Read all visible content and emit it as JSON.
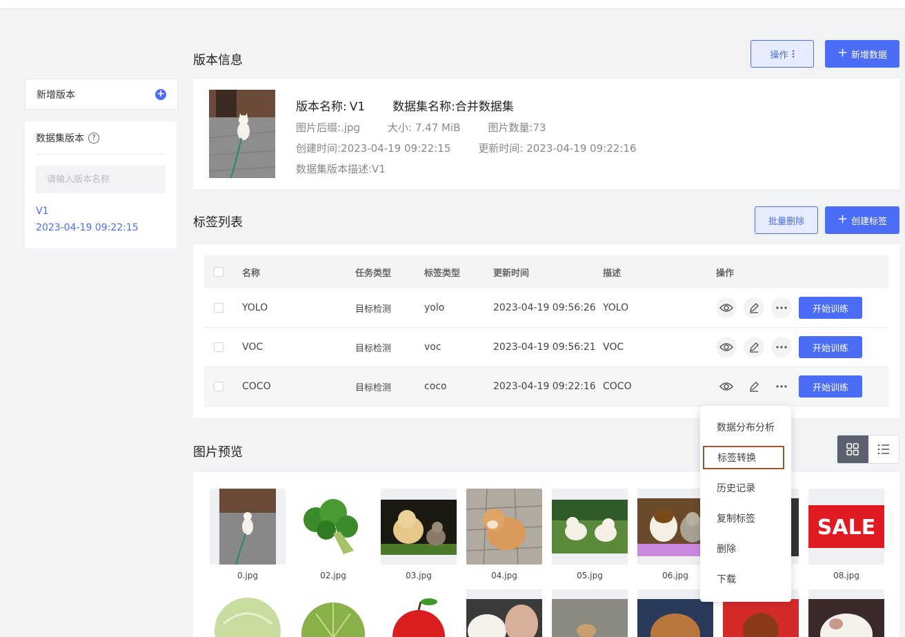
{
  "sidebar": {
    "add_version_label": "新增版本",
    "panel_title": "数据集版本",
    "search_placeholder": "请输入版本名称",
    "versions": [
      {
        "name": "V1",
        "date": "2023-04-19 09:22:15"
      }
    ]
  },
  "version_info": {
    "title": "版本信息",
    "actions_label": "操作",
    "add_data_label": "新增数据",
    "name_label": "版本名称:",
    "name_value": "V1",
    "dataset_label": "数据集名称:",
    "dataset_value": "合并数据集",
    "suffix": "图片后缀:.jpg",
    "size": "大小: 7.47 MiB",
    "count": "图片数量:73",
    "created": "创建时间:2023-04-19 09:22:15",
    "updated": "更新时间: 2023-04-19 09:22:16",
    "description": "数据集版本描述:V1"
  },
  "labels": {
    "title": "标签列表",
    "batch_delete_label": "批量删除",
    "create_label": "创建标签",
    "columns": [
      "名称",
      "任务类型",
      "标签类型",
      "更新时间",
      "描述",
      "操作"
    ],
    "rows": [
      {
        "name": "YOLO",
        "task": "目标检测",
        "type": "yolo",
        "updated": "2023-04-19 09:56:26",
        "desc": "YOLO",
        "train": "开始训练"
      },
      {
        "name": "VOC",
        "task": "目标检测",
        "type": "voc",
        "updated": "2023-04-19 09:56:21",
        "desc": "VOC",
        "train": "开始训练"
      },
      {
        "name": "COCO",
        "task": "目标检测",
        "type": "coco",
        "updated": "2023-04-19 09:22:16",
        "desc": "COCO",
        "train": "开始训练"
      }
    ]
  },
  "dropdown": {
    "items": [
      "数据分布分析",
      "标签转换",
      "历史记录",
      "复制标签",
      "删除",
      "下载"
    ],
    "selected": "标签转换"
  },
  "preview": {
    "title": "图片预览",
    "images": [
      "0.jpg",
      "02.jpg",
      "03.jpg",
      "04.jpg",
      "05.jpg",
      "06.jpg",
      "",
      "08.jpg"
    ]
  },
  "colors": {
    "primary": "#4a6cf7",
    "dropdown_highlight": "#a0522d"
  }
}
